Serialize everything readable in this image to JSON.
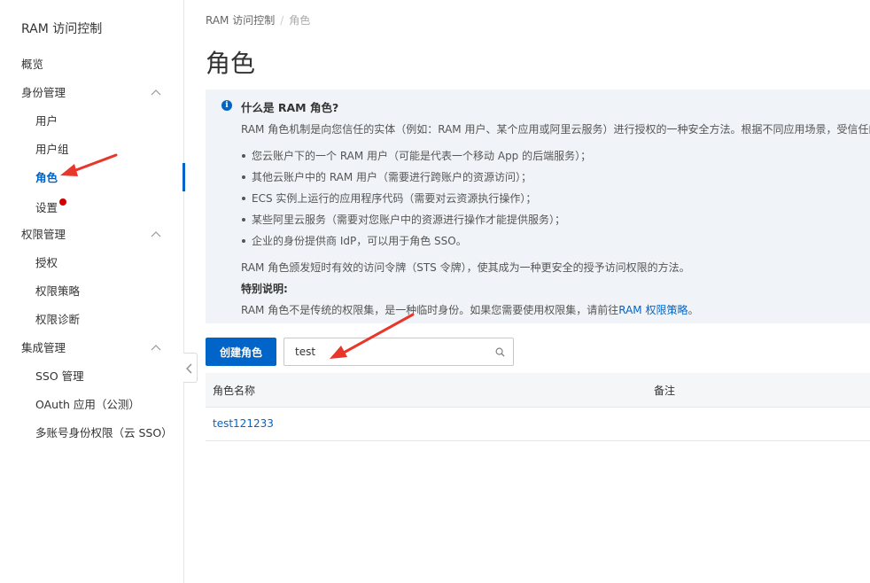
{
  "sidebar": {
    "title": "RAM 访问控制",
    "overview": "概览",
    "groups": [
      {
        "label": "身份管理",
        "items": [
          "用户",
          "用户组",
          "角色",
          "设置"
        ]
      },
      {
        "label": "权限管理",
        "items": [
          "授权",
          "权限策略",
          "权限诊断"
        ]
      },
      {
        "label": "集成管理",
        "items": [
          "SSO 管理",
          "OAuth 应用（公测）",
          "多账号身份权限（云 SSO）"
        ]
      }
    ],
    "active": "角色"
  },
  "breadcrumb": {
    "root": "RAM 访问控制",
    "sep": "/",
    "current": "角色"
  },
  "page_title": "角色",
  "info": {
    "title": "什么是 RAM 角色?",
    "intro": "RAM 角色机制是向您信任的实体（例如：RAM 用户、某个应用或阿里云服务）进行授权的一种安全方法。根据不同应用场景，受信任的",
    "bullets": [
      "您云账户下的一个 RAM 用户（可能是代表一个移动 App 的后端服务）；",
      "其他云账户中的 RAM 用户（需要进行跨账户的资源访问）；",
      "ECS 实例上运行的应用程序代码（需要对云资源执行操作）；",
      "某些阿里云服务（需要对您账户中的资源进行操作才能提供服务）；",
      "企业的身份提供商 IdP，可以用于角色 SSO。"
    ],
    "sts": "RAM 角色颁发短时有效的访问令牌（STS 令牌），使其成为一种更安全的授予访问权限的方法。",
    "note_title": "特别说明:",
    "note_text": "RAM 角色不是传统的权限集，是一种临时身份。如果您需要使用权限集，请前往",
    "note_link": "RAM 权限策略",
    "note_end": "。"
  },
  "toolbar": {
    "create_label": "创建角色",
    "search_value": "test"
  },
  "table": {
    "columns": [
      "角色名称",
      "备注"
    ],
    "rows": [
      {
        "name": "test121233",
        "note": ""
      }
    ]
  },
  "colors": {
    "primary": "#0064c8",
    "info_bg": "#f0f4f8",
    "annotation_red": "#e8362b"
  }
}
